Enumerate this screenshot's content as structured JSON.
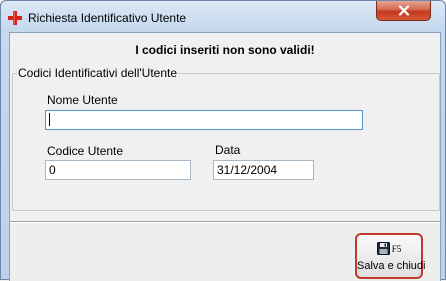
{
  "window": {
    "title": "Richiesta Identificativo Utente",
    "close_label": "X"
  },
  "message": {
    "error_text": "I codici inseriti non sono validi!"
  },
  "group": {
    "legend": "Codici Identificativi dell'Utente"
  },
  "fields": {
    "nome_utente": {
      "label": "Nome Utente",
      "value": ""
    },
    "codice_utente": {
      "label": "Codice Utente",
      "value": "0"
    },
    "data": {
      "label": "Data",
      "value": "31/12/2004"
    }
  },
  "footer": {
    "save_button": {
      "label": "Salva e chiudi",
      "shortcut": "F5",
      "icon": "floppy-disk-icon"
    }
  },
  "colors": {
    "accent_border": "#c0392b",
    "close_button": "#c4391d",
    "titlebar": "#c4d8ee"
  }
}
